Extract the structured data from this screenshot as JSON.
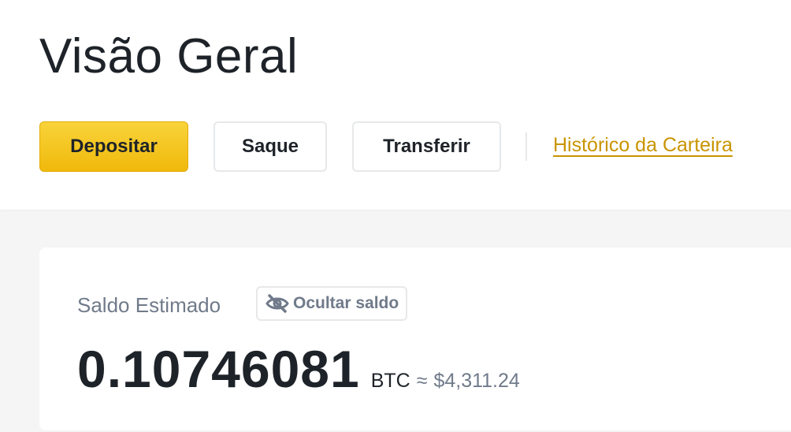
{
  "header": {
    "title": "Visão Geral",
    "buttons": {
      "deposit": "Depositar",
      "withdraw": "Saque",
      "transfer": "Transferir"
    },
    "history_link": "Histórico da Carteira"
  },
  "balance": {
    "label": "Saldo Estimado",
    "hide_button": "Ocultar saldo",
    "hide_icon": "eye-off-icon",
    "value": "0.10746081",
    "unit": "BTC",
    "approx_symbol": "≈",
    "fiat_value": "$4,311.24"
  },
  "colors": {
    "accent": "#f0b90b",
    "link": "#c99400",
    "text_primary": "#1e2329",
    "text_secondary": "#707a8a"
  }
}
